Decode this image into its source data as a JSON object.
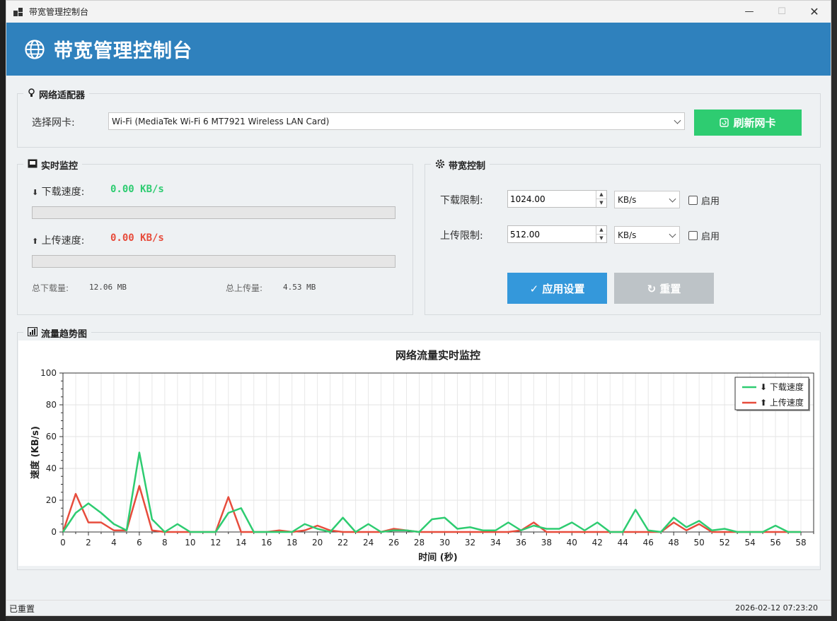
{
  "window": {
    "title": "带宽管理控制台"
  },
  "header": {
    "title": "带宽管理控制台"
  },
  "adapter": {
    "group_title": "网络适配器",
    "select_label": "选择网卡:",
    "selected": "Wi-Fi (MediaTek Wi-Fi 6 MT7921 Wireless LAN Card)",
    "refresh_label": "刷新网卡"
  },
  "monitor": {
    "group_title": "实时监控",
    "download_label": "下载速度:",
    "download_value": "0.00 KB/s",
    "download_progress": 0,
    "upload_label": "上传速度:",
    "upload_value": "0.00 KB/s",
    "upload_progress": 0,
    "total_down_label": "总下载量:",
    "total_down_value": "12.06 MB",
    "total_up_label": "总上传量:",
    "total_up_value": "4.53 MB"
  },
  "control": {
    "group_title": "带宽控制",
    "download_limit_label": "下载限制:",
    "download_limit_value": "1024.00",
    "download_unit": "KB/s",
    "upload_limit_label": "上传限制:",
    "upload_limit_value": "512.00",
    "upload_unit": "KB/s",
    "enable_label": "启用",
    "download_enabled": false,
    "upload_enabled": false,
    "apply_label": "✓ 应用设置",
    "reset_label": "↻ 重置"
  },
  "trend": {
    "group_title": "流量趋势图"
  },
  "chart_data": {
    "type": "line",
    "title": "网络流量实时监控",
    "xlabel": "时间 (秒)",
    "ylabel": "速度 (KB/s)",
    "xlim": [
      0,
      59
    ],
    "ylim": [
      0,
      100
    ],
    "xticks": [
      0,
      2,
      4,
      6,
      8,
      10,
      12,
      14,
      16,
      18,
      20,
      22,
      24,
      26,
      28,
      30,
      32,
      34,
      36,
      38,
      40,
      42,
      44,
      46,
      48,
      50,
      52,
      54,
      56,
      58
    ],
    "yticks": [
      0,
      20,
      40,
      60,
      80,
      100
    ],
    "grid": true,
    "legend_position": "top-right",
    "x": [
      0,
      1,
      2,
      3,
      4,
      5,
      6,
      7,
      8,
      9,
      10,
      11,
      12,
      13,
      14,
      15,
      16,
      17,
      18,
      19,
      20,
      21,
      22,
      23,
      24,
      25,
      26,
      27,
      28,
      29,
      30,
      31,
      32,
      33,
      34,
      35,
      36,
      37,
      38,
      39,
      40,
      41,
      42,
      43,
      44,
      45,
      46,
      47,
      48,
      49,
      50,
      51,
      52,
      53,
      54,
      55,
      56,
      57,
      58
    ],
    "series": [
      {
        "name": "⬇ 下载速度",
        "color": "#2ecc71",
        "values": [
          0,
          12,
          18,
          12,
          5,
          1,
          50,
          8,
          0,
          5,
          0,
          0,
          0,
          12,
          15,
          0,
          0,
          0,
          0,
          5,
          2,
          0,
          9,
          0,
          5,
          0,
          1,
          1,
          0,
          8,
          9,
          2,
          3,
          1,
          1,
          6,
          1,
          4,
          2,
          2,
          6,
          1,
          6,
          0,
          0,
          14,
          1,
          0,
          9,
          3,
          7,
          1,
          2,
          0,
          0,
          0,
          4,
          0,
          0
        ]
      },
      {
        "name": "⬆ 上传速度",
        "color": "#e74c3c",
        "values": [
          0,
          24,
          6,
          6,
          1,
          1,
          29,
          1,
          0,
          0,
          0,
          0,
          0,
          22,
          0,
          0,
          0,
          1,
          0,
          1,
          4,
          1,
          0,
          0,
          0,
          0,
          2,
          1,
          0,
          0,
          0,
          0,
          0,
          0,
          0,
          0,
          1,
          6,
          0,
          0,
          0,
          0,
          0,
          0,
          0,
          0,
          0,
          0,
          6,
          1,
          5,
          0,
          0,
          0,
          0,
          0,
          0,
          0,
          0
        ]
      }
    ]
  },
  "status": {
    "left": "已重置",
    "right": "2026-02-12 07:23:20"
  }
}
